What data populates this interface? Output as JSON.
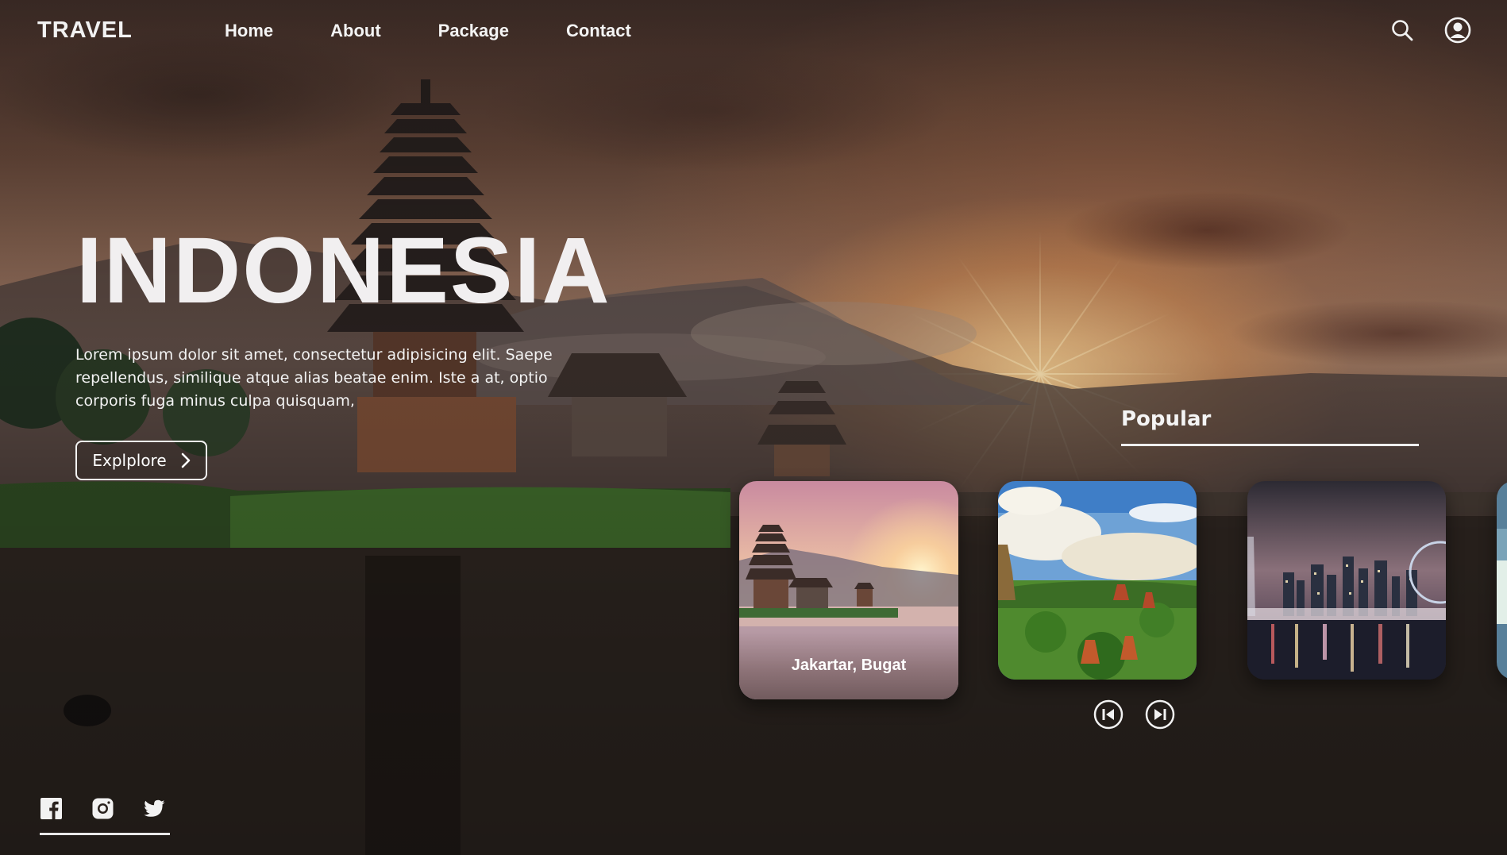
{
  "header": {
    "logo": "TRAVEL",
    "nav": [
      "Home",
      "About",
      "Package",
      "Contact"
    ],
    "icons": [
      "search-icon",
      "user-account-icon"
    ]
  },
  "hero": {
    "title": "INDONESIA",
    "description": "Lorem ipsum dolor sit amet, consectetur adipisicing elit. Saepe repellendus, similique atque alias beatae enim. Iste a at, optio corporis fuga minus culpa quisquam,",
    "explore_label": "Explplore",
    "explore_icon": "chevron-right-icon"
  },
  "popular": {
    "heading": "Popular",
    "cards": [
      {
        "caption": "Jakartar, Bugat",
        "image": "bali-temple-sunset"
      },
      {
        "caption": "",
        "image": "temple-park-landscape"
      },
      {
        "caption": "",
        "image": "city-skyline-night"
      },
      {
        "caption": "",
        "image": "partial-card"
      }
    ],
    "controls": [
      "skip-previous-icon",
      "skip-next-icon"
    ]
  },
  "social": {
    "icons": [
      "facebook-icon",
      "instagram-icon",
      "twitter-icon"
    ]
  },
  "colors": {
    "text": "#ffffff",
    "rule": "#eeeeee",
    "bg_dark": "#2a1d18"
  }
}
